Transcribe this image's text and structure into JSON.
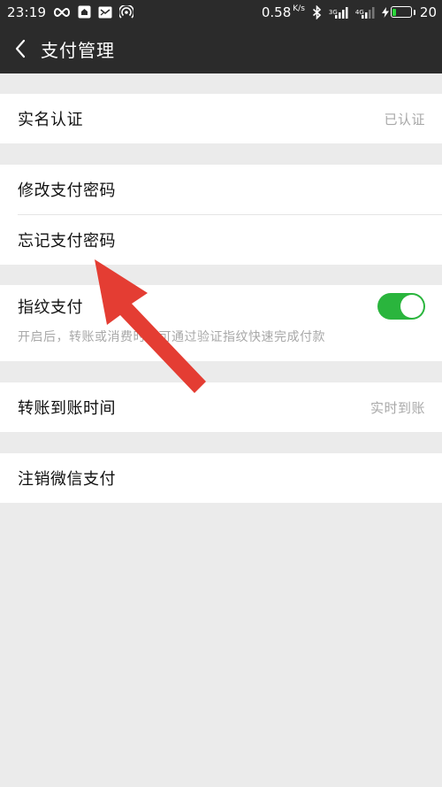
{
  "status_bar": {
    "time": "23:19",
    "speed": "0.58",
    "speed_unit": "K/s",
    "net1": "3G",
    "net2": "4G",
    "battery_level": "20",
    "battery_fraction": 0.2
  },
  "header": {
    "title": "支付管理"
  },
  "sections": {
    "realname": {
      "label": "实名认证",
      "value": "已认证"
    },
    "change_password": {
      "label": "修改支付密码"
    },
    "forgot_password": {
      "label": "忘记支付密码"
    },
    "fingerprint": {
      "label": "指纹支付",
      "enabled": true,
      "hint": "开启后，转账或消费时，可通过验证指纹快速完成付款"
    },
    "transfer_time": {
      "label": "转账到账时间",
      "value": "实时到账"
    },
    "cancel_pay": {
      "label": "注销微信支付"
    }
  },
  "colors": {
    "toggle_on": "#2ab53d",
    "annotation_arrow": "#e43d33",
    "header_bg": "#2b2b2b"
  }
}
